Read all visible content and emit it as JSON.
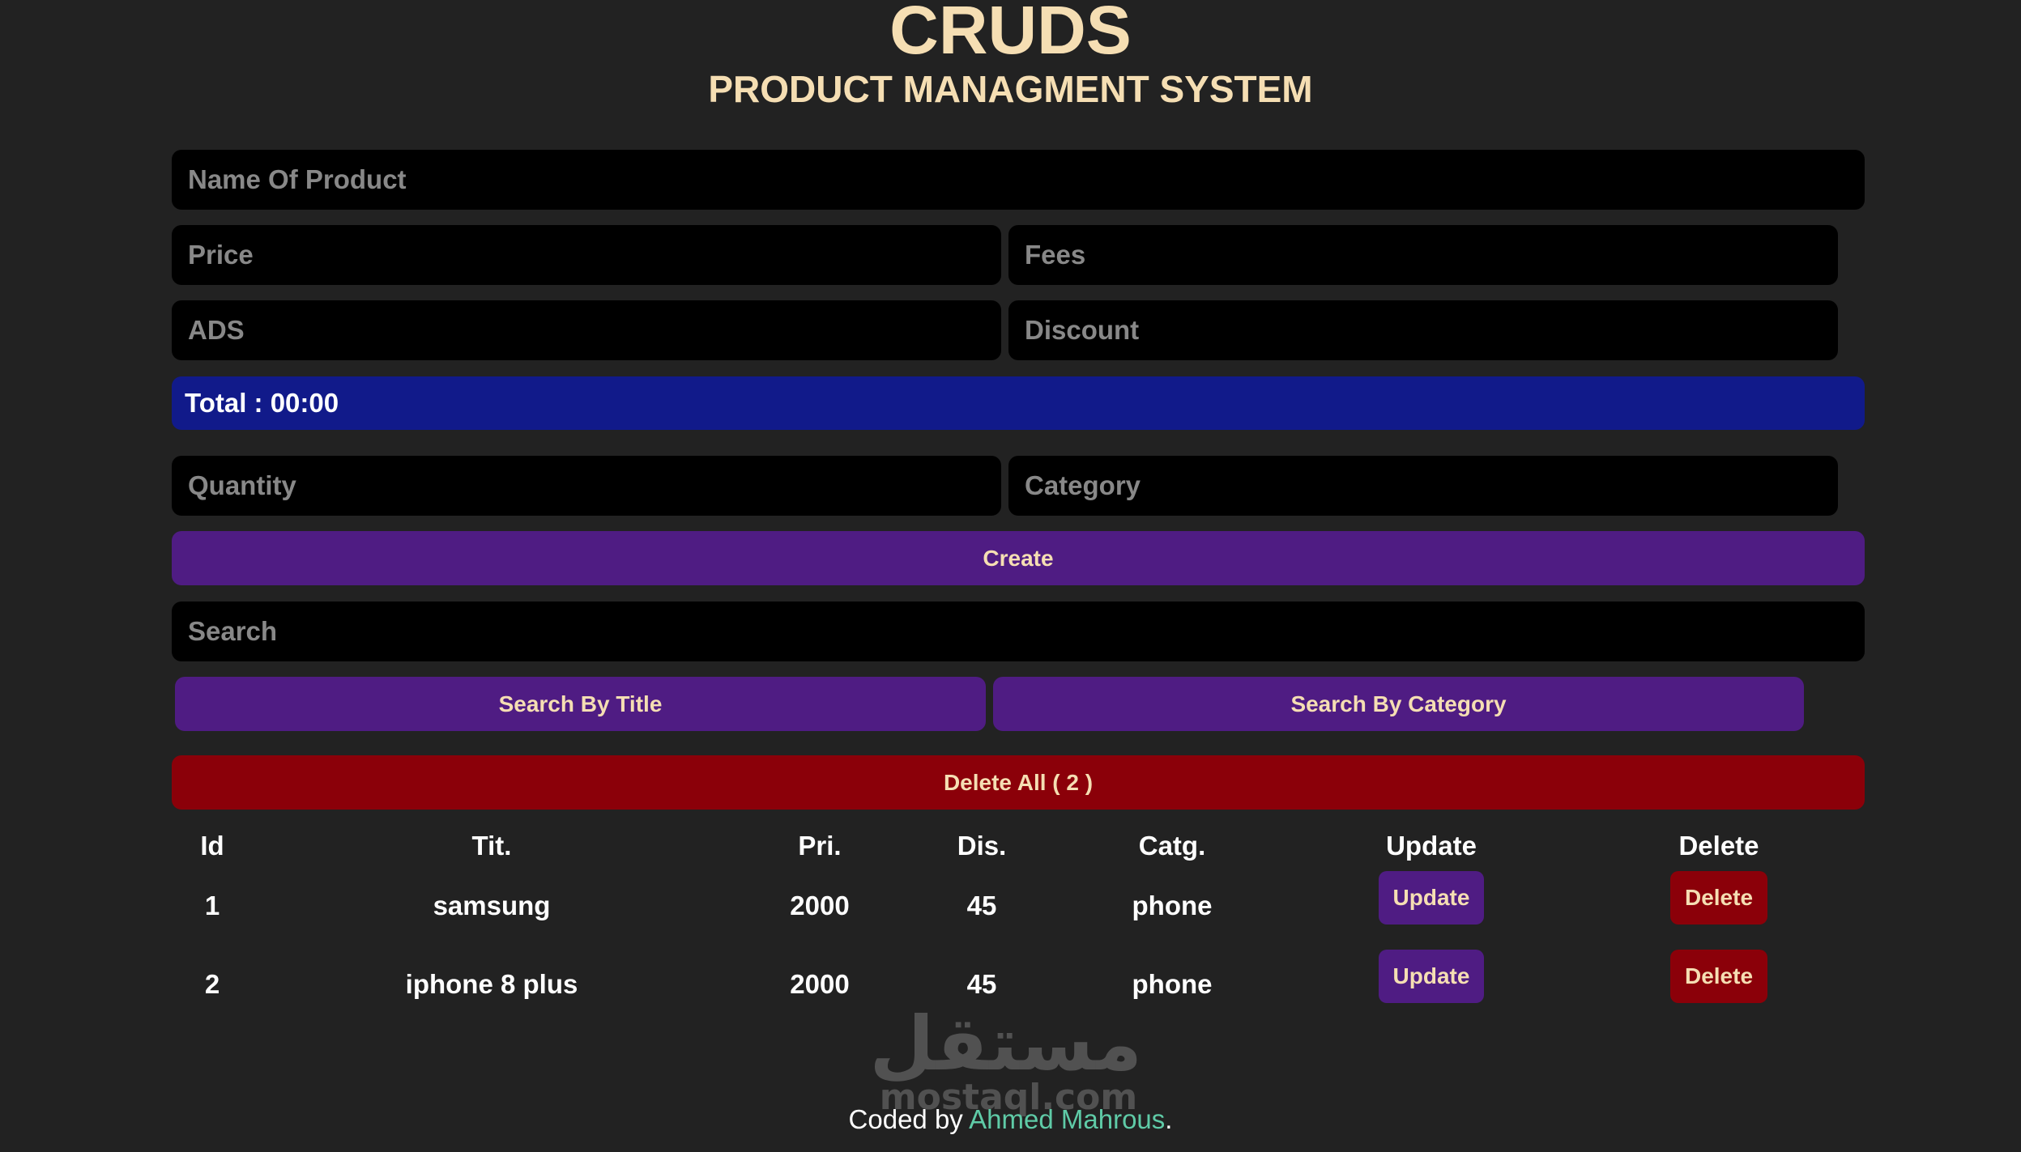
{
  "header": {
    "title": "CRUDS",
    "subtitle": "PRODUCT MANAGMENT SYSTEM"
  },
  "form": {
    "name_placeholder": "Name Of Product",
    "price_placeholder": "Price",
    "fees_placeholder": "Fees",
    "ads_placeholder": "ADS",
    "discount_placeholder": "Discount",
    "total_label": "Total : 00:00",
    "quantity_placeholder": "Quantity",
    "category_placeholder": "Category",
    "create_label": "Create"
  },
  "search": {
    "placeholder": "Search",
    "by_title_label": "Search By Title",
    "by_category_label": "Search By Category"
  },
  "delete_all_label": "Delete All ( 2 )",
  "table": {
    "headers": [
      "Id",
      "Tit.",
      "Pri.",
      "Dis.",
      "Catg.",
      "Update",
      "Delete"
    ],
    "rows": [
      {
        "id": "1",
        "title": "samsung",
        "price": "2000",
        "discount": "45",
        "category": "phone",
        "update_label": "Update",
        "delete_label": "Delete"
      },
      {
        "id": "2",
        "title": "iphone 8 plus",
        "price": "2000",
        "discount": "45",
        "category": "phone",
        "update_label": "Update",
        "delete_label": "Delete"
      }
    ]
  },
  "watermark": {
    "arabic": "مستقل",
    "latin": "mostaql.com"
  },
  "footer": {
    "prefix": "Coded by ",
    "author": "Ahmed Mahrous",
    "suffix": "."
  },
  "colors": {
    "background": "#222222",
    "accent_text": "#f5deb3",
    "total_bg": "#111a8a",
    "button_purple": "#4f1c83",
    "button_red": "#8b0009",
    "link": "#5fcba7"
  }
}
